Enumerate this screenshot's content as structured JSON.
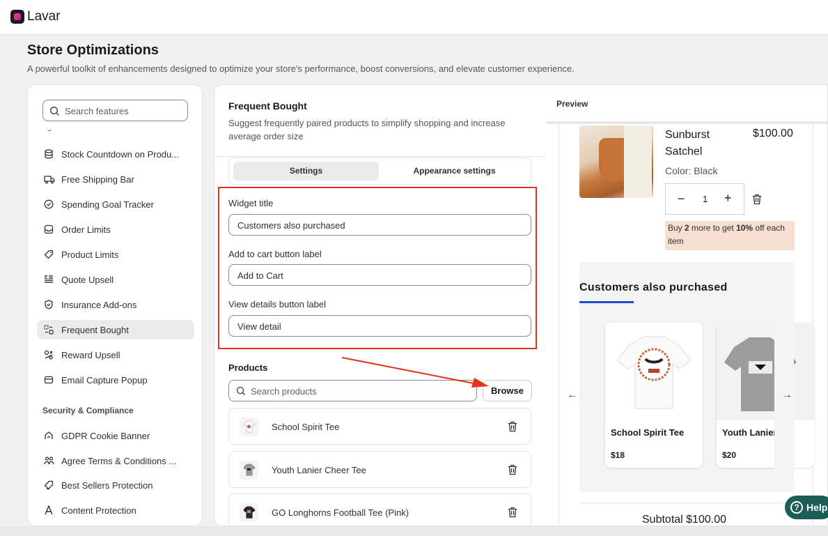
{
  "app": {
    "name": "Lavar"
  },
  "page": {
    "title": "Store Optimizations",
    "subtitle": "A powerful toolkit of enhancements designed to optimize your store's performance, boost conversions, and elevate customer experience."
  },
  "sidebar": {
    "search_placeholder": "Search features",
    "items": [
      {
        "label": "Stock Countdown on Produ...",
        "icon": "database-icon"
      },
      {
        "label": "Free Shipping Bar",
        "icon": "truck-icon"
      },
      {
        "label": "Spending Goal Tracker",
        "icon": "check-circle-icon"
      },
      {
        "label": "Order Limits",
        "icon": "inbox-icon"
      },
      {
        "label": "Product Limits",
        "icon": "tag-icon"
      },
      {
        "label": "Quote Upsell",
        "icon": "list-icon"
      },
      {
        "label": "Insurance Add-ons",
        "icon": "shield-check-icon"
      },
      {
        "label": "Frequent Bought",
        "icon": "bundle-icon",
        "active": true
      },
      {
        "label": "Reward Upsell",
        "icon": "reward-icon"
      },
      {
        "label": "Email Capture Popup",
        "icon": "mail-icon"
      }
    ],
    "section2_title": "Security & Compliance",
    "items2": [
      {
        "label": "GDPR Cookie Banner",
        "icon": "cookie-icon"
      },
      {
        "label": "Agree Terms & Conditions ...",
        "icon": "people-icon"
      },
      {
        "label": "Best Sellers Protection",
        "icon": "tag-protect-icon"
      },
      {
        "label": "Content Protection",
        "icon": "text-icon"
      }
    ]
  },
  "feature": {
    "title": "Frequent Bought",
    "description": "Suggest frequently paired products to simplify shopping and increase average order size",
    "tabs": [
      "Settings",
      "Appearance settings"
    ],
    "active_tab": "Settings",
    "fields": {
      "widget_title_label": "Widget title",
      "widget_title_value": "Customers also purchased",
      "cart_label": "Add to cart button label",
      "cart_value": "Add to Cart",
      "view_label": "View details button label",
      "view_value": "View detail"
    },
    "products_heading": "Products",
    "products_search_placeholder": "Search products",
    "browse_label": "Browse",
    "products": [
      {
        "name": "School Spirit Tee"
      },
      {
        "name": "Youth Lanier Cheer Tee"
      },
      {
        "name": "GO Longhorns Football Tee (Pink)"
      }
    ]
  },
  "preview": {
    "label": "Preview",
    "cart_item": {
      "name": "Sunburst Satchel",
      "price": "$100.00",
      "color": "Color: Black",
      "qty": "1"
    },
    "promo": {
      "pre": "Buy ",
      "num": "2",
      "mid": " more to get ",
      "pct": "10%",
      "post": " off each item"
    },
    "upsell_title": "Customers also purchased",
    "cards": [
      {
        "name": "School Spirit Tee",
        "price": "$18"
      },
      {
        "name": "Youth Lanier",
        "price": "$20"
      }
    ],
    "subtotal": "Subtotal $100.00"
  },
  "help_label": "Help",
  "colors": {
    "accent_red": "#e5321c",
    "nav_blue": "#1c4fbf",
    "help_green": "#1b5e57"
  }
}
